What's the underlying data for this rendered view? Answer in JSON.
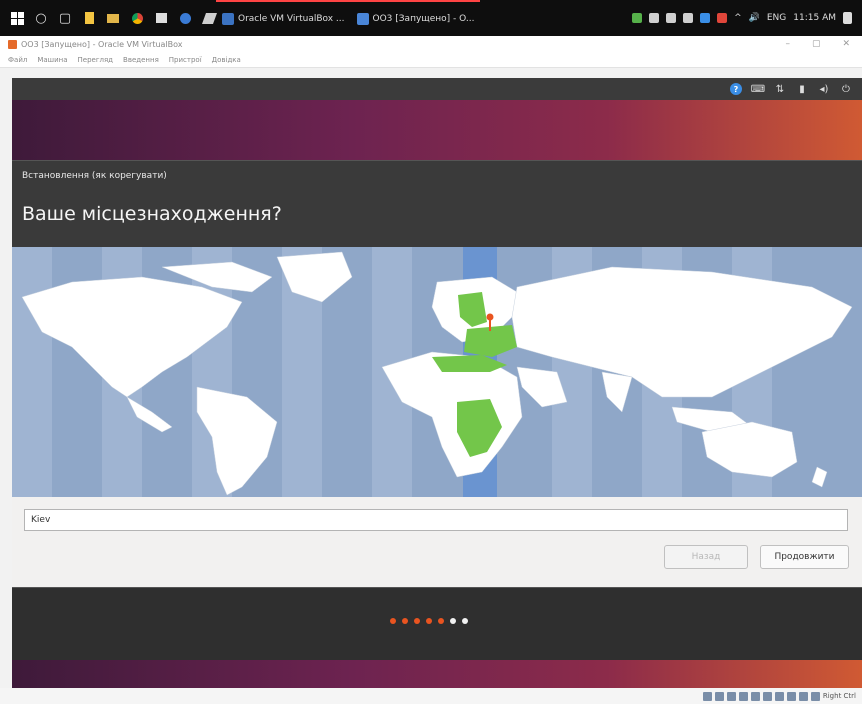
{
  "taskbar": {
    "tasks": [
      {
        "label": "Oracle VM VirtualBox ...",
        "icon": "virtualbox-icon"
      },
      {
        "label": "OO3 [Запущено] - O...",
        "icon": "vm-window-icon"
      }
    ],
    "lang": "ENG",
    "time": "11:15 AM"
  },
  "vbox": {
    "title": "OO3 [Запущено] - Oracle VM VirtualBox",
    "menu": [
      "Файл",
      "Машина",
      "Перегляд",
      "Введення",
      "Пристрої",
      "Довідка"
    ]
  },
  "installer": {
    "subtitle": "Встановлення (як корегувати)",
    "title": "Ваше місцезнаходження?",
    "location_value": "Kiev",
    "back_label": "Назад",
    "next_label": "Продовжити",
    "steps_total": 7,
    "steps_done": 5,
    "colors": {
      "accent": "#e95420",
      "map_ocean": "#8fa7c8",
      "highlight_zone": "#6a94d0",
      "region": "#73c64a"
    }
  },
  "status_bar": {
    "host_key": "Right Ctrl"
  }
}
